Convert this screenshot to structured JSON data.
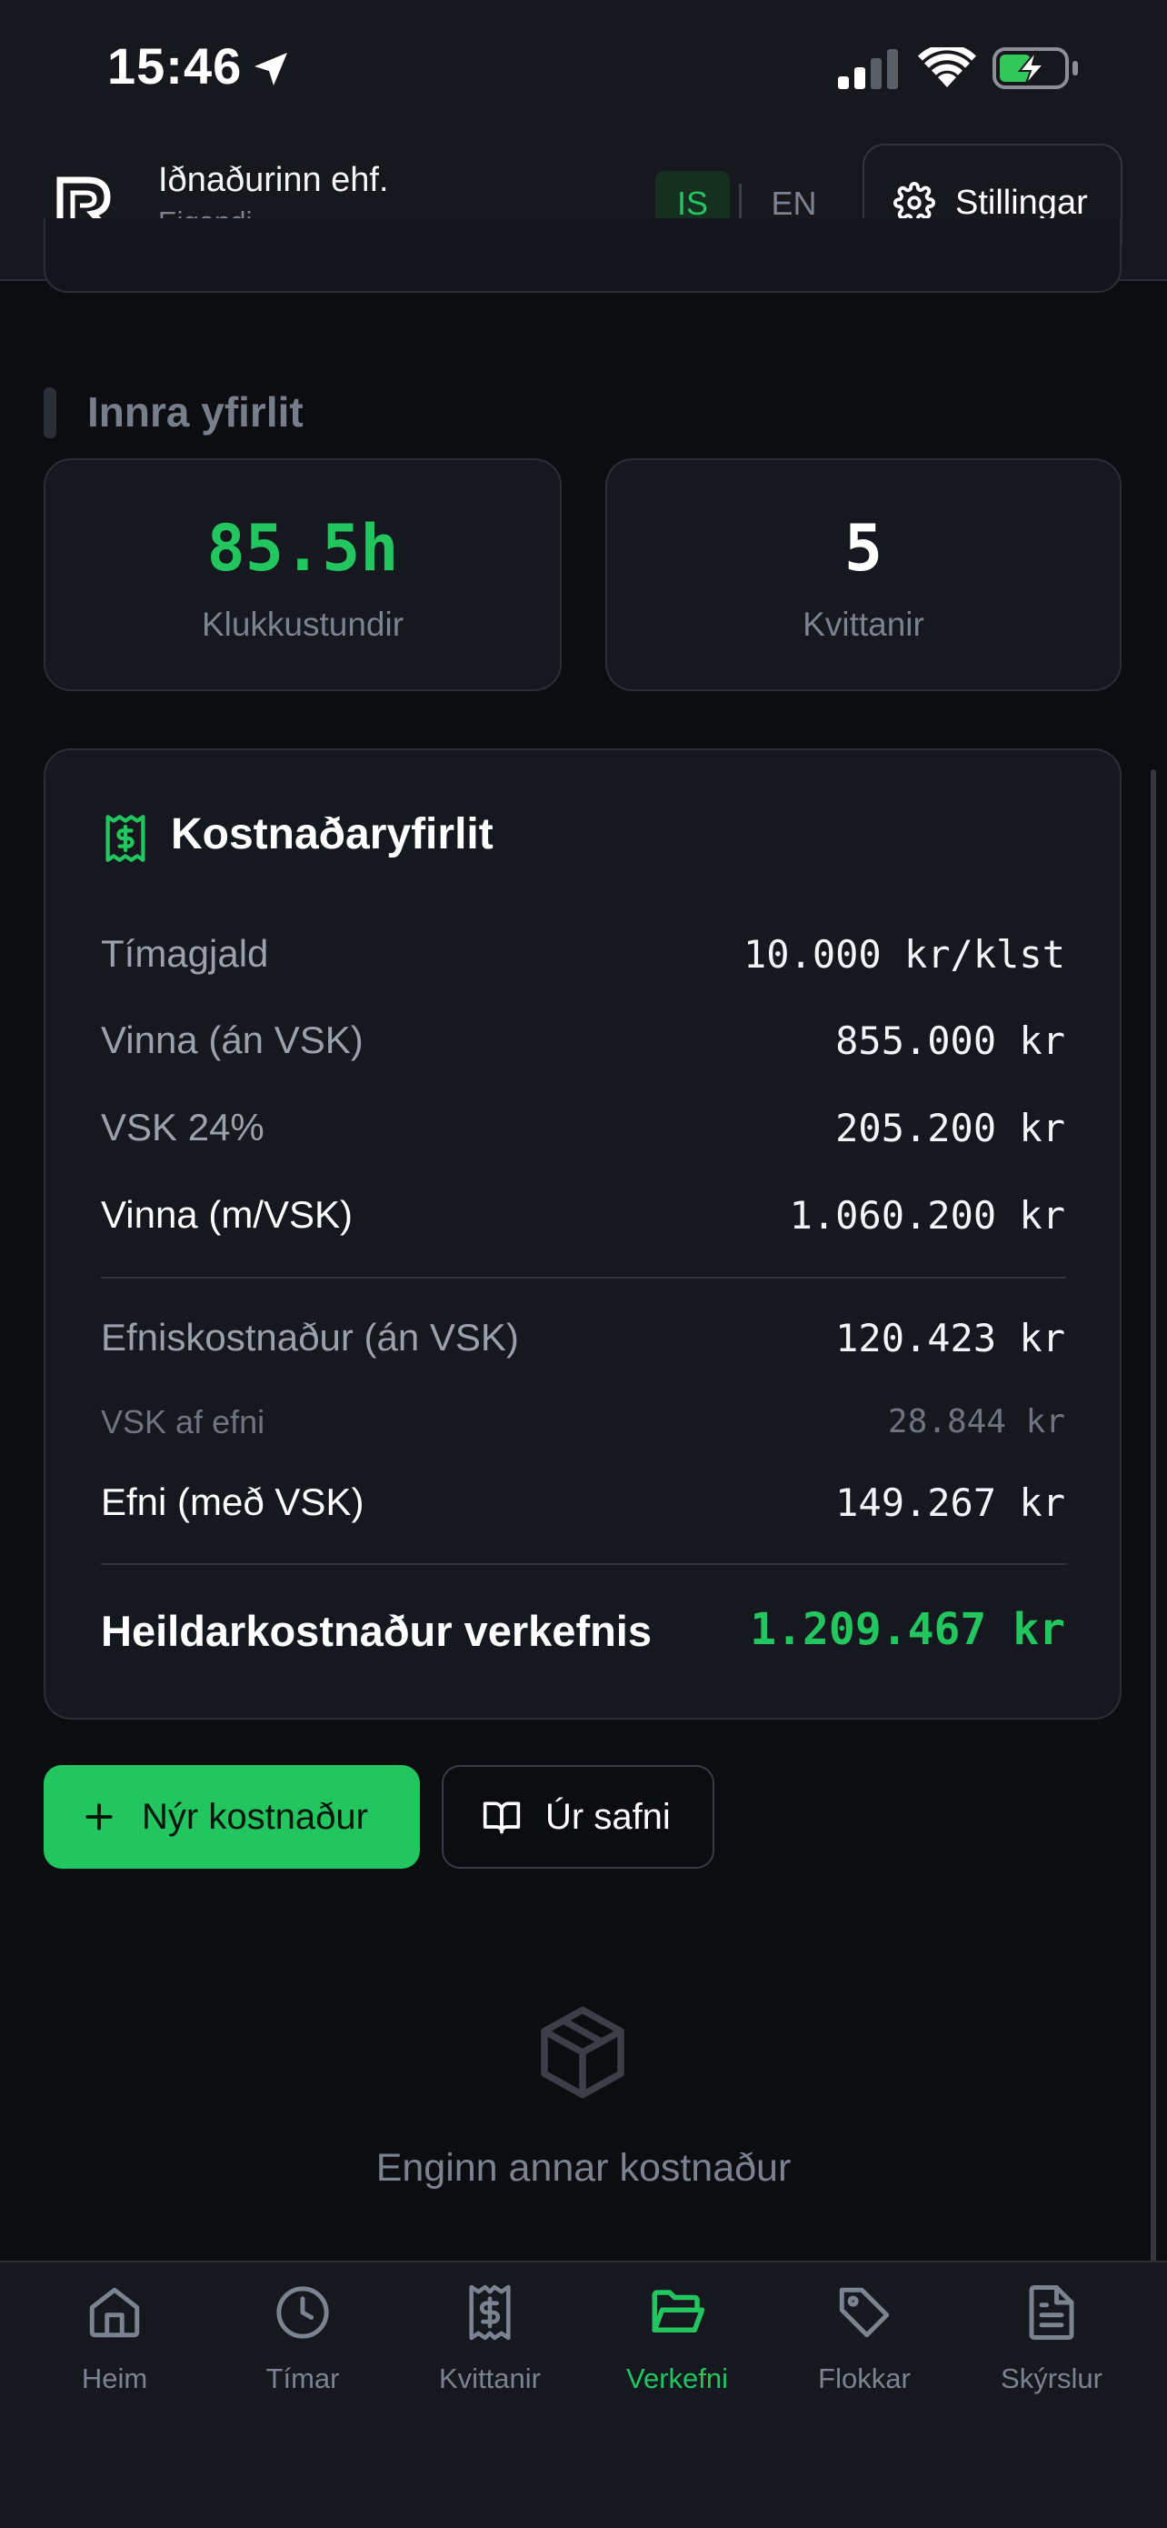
{
  "status_bar": {
    "time": "15:46"
  },
  "header": {
    "company": "Iðnaðurinn ehf.",
    "role": "Eigandi",
    "lang_is": "IS",
    "lang_en": "EN",
    "settings_label": "Stillingar"
  },
  "section": {
    "title": "Innra yfirlit"
  },
  "stats": [
    {
      "value": "85.5h",
      "label": "Klukkustundir",
      "color": "#22c55e"
    },
    {
      "value": "5",
      "label": "Kvittanir",
      "color": "#ffffff"
    }
  ],
  "cost": {
    "title": "Kostnaðaryfirlit",
    "hourly_label": "Tímagjald",
    "hourly_value": "10.000 kr/klst",
    "labor_ex_label": "Vinna (án VSK)",
    "labor_ex_value": "855.000 kr",
    "vat_label": "VSK 24%",
    "vat_value": "205.200 kr",
    "labor_inc_label": "Vinna (m/VSK)",
    "labor_inc_value": "1.060.200 kr",
    "material_ex_label": "Efniskostnaður (án VSK)",
    "material_ex_value": "120.423 kr",
    "material_vat_label": "VSK af efni",
    "material_vat_value": "28.844 kr",
    "material_inc_label": "Efni (með VSK)",
    "material_inc_value": "149.267 kr",
    "total_label": "Heildarkostnaður verkefnis",
    "total_value": "1.209.467 kr",
    "accent": "#22c55e"
  },
  "actions": {
    "new_cost": "Nýr kostnaður",
    "from_library": "Úr safni"
  },
  "empty_state": {
    "text": "Enginn annar kostnaður",
    "icon": "box-icon"
  },
  "nav": [
    {
      "label": "Heim",
      "icon": "home-icon"
    },
    {
      "label": "Tímar",
      "icon": "clock-icon"
    },
    {
      "label": "Kvittanir",
      "icon": "receipt-icon"
    },
    {
      "label": "Verkefni",
      "icon": "folder-icon",
      "active": true
    },
    {
      "label": "Flokkar",
      "icon": "tag-icon"
    },
    {
      "label": "Skýrslur",
      "icon": "file-text-icon"
    }
  ]
}
